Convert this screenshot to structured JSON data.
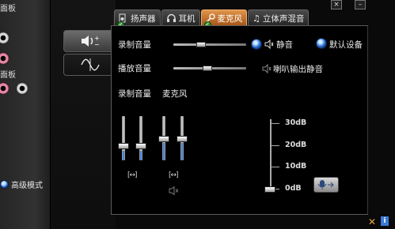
{
  "left_panel": {
    "top_label": "面板",
    "mid_label": "面板",
    "advanced_mode_label": "高级模式"
  },
  "tabs": [
    {
      "label": "扬声器",
      "icon": "speaker-icon",
      "active": false
    },
    {
      "label": "耳机",
      "icon": "headphones-icon",
      "active": false
    },
    {
      "label": "麦克风",
      "icon": "microphone-icon",
      "active": true
    },
    {
      "label": "立体声混音",
      "icon": "music-note-icon",
      "active": false
    }
  ],
  "window_buttons": {
    "close": "×",
    "minimize": "–"
  },
  "main": {
    "record_volume_label": "录制音量",
    "playback_volume_label": "播放音量",
    "mute_label": "静音",
    "default_device_label": "默认设备",
    "speaker_output_mute_label": "喇叭输出静音",
    "record_volume_col_label": "录制音量",
    "mic_col_label": "麦克风",
    "link_glyph": "[↔]",
    "db_scale": [
      "30dB",
      "20dB",
      "10dB",
      "0dB"
    ],
    "record_volume": 0.38,
    "playback_volume": 0.47,
    "mic_boost_db": 0
  },
  "colors": {
    "active_tab": "#d47a30",
    "accent_blue": "#3f86e6"
  }
}
